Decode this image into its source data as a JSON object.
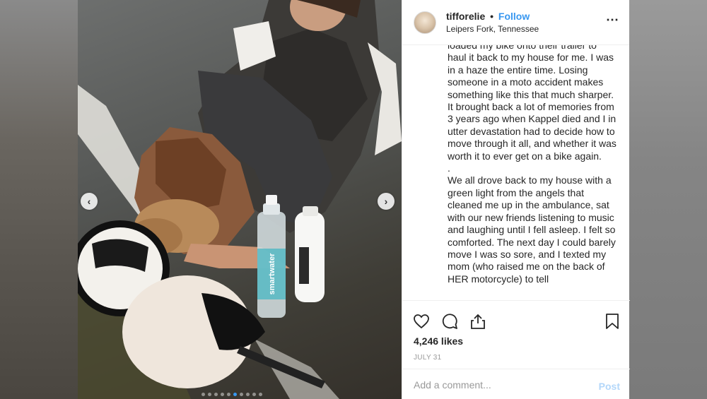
{
  "post": {
    "username": "tifforelie",
    "separator": "•",
    "follow_label": "Follow",
    "location": "Leipers Fork, Tennessee",
    "more_icon": "more-horizontal-icon",
    "caption_lines": [
      "loaded my bike onto their trailer to haul it back to my house for me. I was in a haze the entire time. Losing someone in a moto accident makes something like this that much sharper. It brought back a lot of memories from 3 years ago when Kappel died and I in utter devastation had to decide how to move through it all, and whether it was worth it to ever get on a bike again.",
      ".",
      "We all drove back to my house with a green light from the angels that cleaned me up in the ambulance, sat with our new friends listening to music and laughing until I fell asleep. I felt so comforted. The next day I could barely move I was so sore, and I texted my mom (who raised me on the back of HER motorcycle) to tell"
    ],
    "likes": "4,246 likes",
    "date": "JULY 31",
    "comment_placeholder": "Add a comment...",
    "post_label": "Post"
  },
  "photo": {
    "bottle_label": "smartwater",
    "carousel_prev": "‹",
    "carousel_next": "›"
  },
  "icons": {
    "like": "heart-icon",
    "comment": "comment-bubble-icon",
    "share": "share-icon",
    "save": "bookmark-icon"
  },
  "colors": {
    "accent": "#3897f0",
    "post_disabled": "#b3d7fa",
    "text": "#262626",
    "muted": "#999999"
  }
}
